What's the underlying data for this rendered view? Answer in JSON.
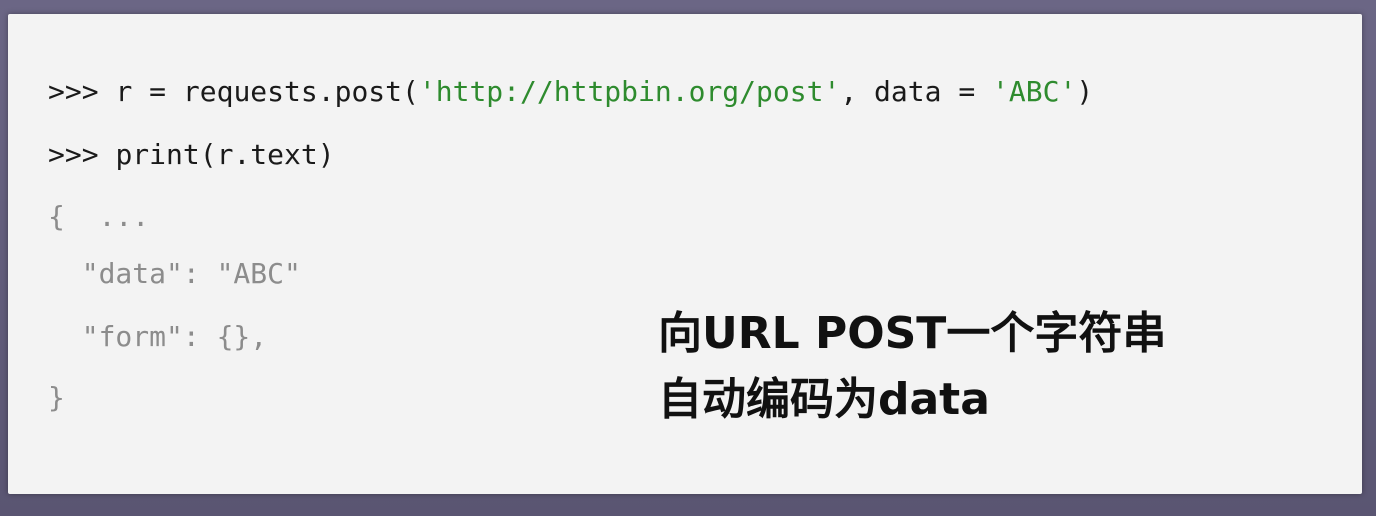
{
  "code": {
    "line1": {
      "prompt": ">>> ",
      "before": "r = requests.post(",
      "url": "'http://httpbin.org/post'",
      "middle": ", data = ",
      "value": "'ABC'",
      "after": ")"
    },
    "line2": {
      "prompt": ">>> ",
      "text": "print(r.text)"
    },
    "output": {
      "open": "{  ...",
      "data_line": "  \"data\": \"ABC\"",
      "form_line": "  \"form\": {},",
      "close": "}"
    }
  },
  "caption": {
    "line1": "向URL POST一个字符串",
    "line2": "自动编码为data"
  },
  "colors": {
    "string": "#2e8b2e",
    "output_text": "#8c8c8c",
    "background": "#5f5a77",
    "card": "#f3f3f3"
  }
}
